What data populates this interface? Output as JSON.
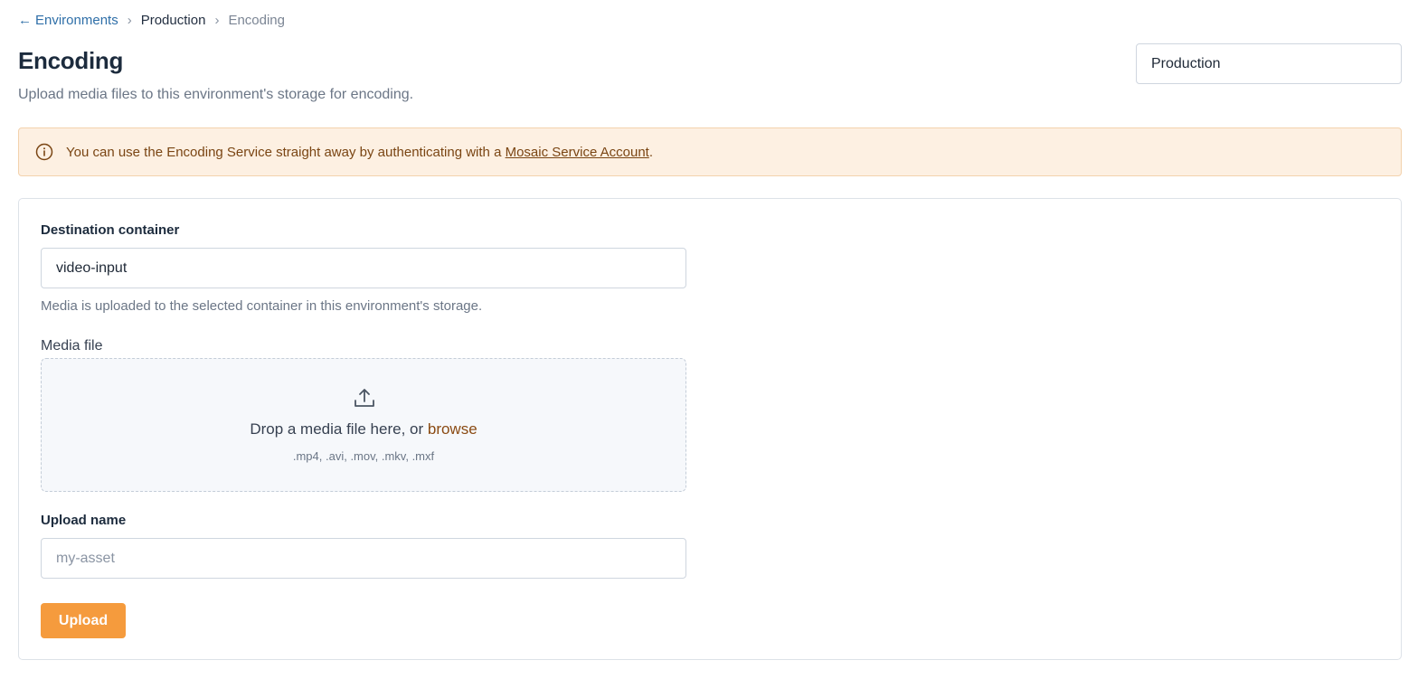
{
  "breadcrumb": {
    "back_arrow": "←",
    "back_label": "Environments",
    "separator": "›",
    "middle": "Production",
    "current": "Encoding"
  },
  "page": {
    "title": "Encoding",
    "subtitle": "Upload media files to this environment's storage for encoding."
  },
  "environment_select": {
    "value": "Production"
  },
  "alert": {
    "icon": "info-icon",
    "text_before": "You can use the Encoding Service straight away by authenticating with a ",
    "link_text": "Mosaic Service Account",
    "text_after": "."
  },
  "form": {
    "destination": {
      "label": "Destination container",
      "value": "video-input",
      "help": "Media is uploaded to the selected container in this environment's storage."
    },
    "media_file": {
      "label": "Media file",
      "icon": "upload-icon",
      "drop_text": "Drop a media file here, or ",
      "browse_label": "browse",
      "accepted_types": ".mp4, .avi, .mov, .mkv, .mxf"
    },
    "upload_name": {
      "label": "Upload name",
      "placeholder": "my-asset"
    },
    "submit_label": "Upload"
  },
  "colors": {
    "link": "#2f6fa8",
    "accent": "#f59b3d",
    "alert_bg": "#fdf0e2",
    "alert_text": "#7a4513"
  }
}
